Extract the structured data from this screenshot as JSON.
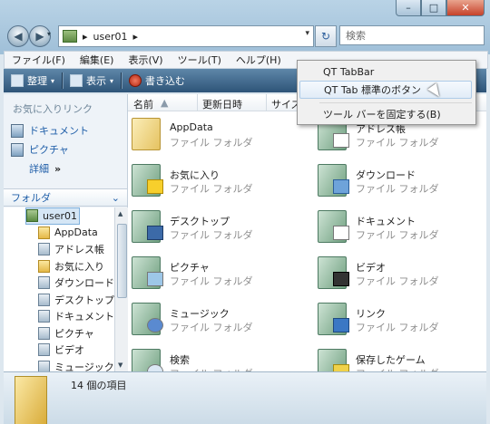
{
  "window": {
    "caption_buttons": {
      "minimize": "–",
      "maximize": "□",
      "close": "✕"
    }
  },
  "nav": {
    "back_icon": "back-arrow-icon",
    "forward_icon": "forward-arrow-icon",
    "breadcrumb_sep": "▸",
    "breadcrumb": "user01",
    "breadcrumb_trail": "▸",
    "address_dropdown": "▾",
    "refresh_glyph": "↻",
    "search_placeholder": "検索"
  },
  "menubar": {
    "items": [
      "ファイル(F)",
      "編集(E)",
      "表示(V)",
      "ツール(T)",
      "ヘルプ(H)"
    ]
  },
  "cmdbar": {
    "organize": "整理",
    "views": "表示",
    "burn": "書き込む",
    "dropdown_arrow": "▾"
  },
  "left": {
    "favorites_title": "お気に入りリンク",
    "favorites": [
      "ドキュメント",
      "ピクチャ"
    ],
    "more": "詳細",
    "more_glyph": "»",
    "folders_header": "フォルダ",
    "folders_chevron": "⌄",
    "tree": [
      "user01",
      "AppData",
      "アドレス帳",
      "お気に入り",
      "ダウンロード",
      "デスクトップ",
      "ドキュメント",
      "ピクチャ",
      "ビデオ",
      "ミュージック"
    ]
  },
  "content": {
    "columns": [
      "名前",
      "更新日時",
      "サイズ"
    ],
    "items": [
      {
        "name": "AppData",
        "type": "ファイル フォルダ"
      },
      {
        "name": "アドレス帳",
        "type": "ファイル フォルダ"
      },
      {
        "name": "お気に入り",
        "type": "ファイル フォルダ"
      },
      {
        "name": "ダウンロード",
        "type": "ファイル フォルダ"
      },
      {
        "name": "デスクトップ",
        "type": "ファイル フォルダ"
      },
      {
        "name": "ドキュメント",
        "type": "ファイル フォルダ"
      },
      {
        "name": "ピクチャ",
        "type": "ファイル フォルダ"
      },
      {
        "name": "ビデオ",
        "type": "ファイル フォルダ"
      },
      {
        "name": "ミュージック",
        "type": "ファイル フォルダ"
      },
      {
        "name": "リンク",
        "type": "ファイル フォルダ"
      },
      {
        "name": "検索",
        "type": "ファイル フォルダ"
      },
      {
        "name": "保存したゲーム",
        "type": "ファイル フォルダ"
      }
    ]
  },
  "status": {
    "count": "14 個の項目"
  },
  "context_menu": {
    "items": [
      "QT TabBar",
      "QT Tab 標準のボタン",
      "ツール バーを固定する(B)"
    ]
  }
}
